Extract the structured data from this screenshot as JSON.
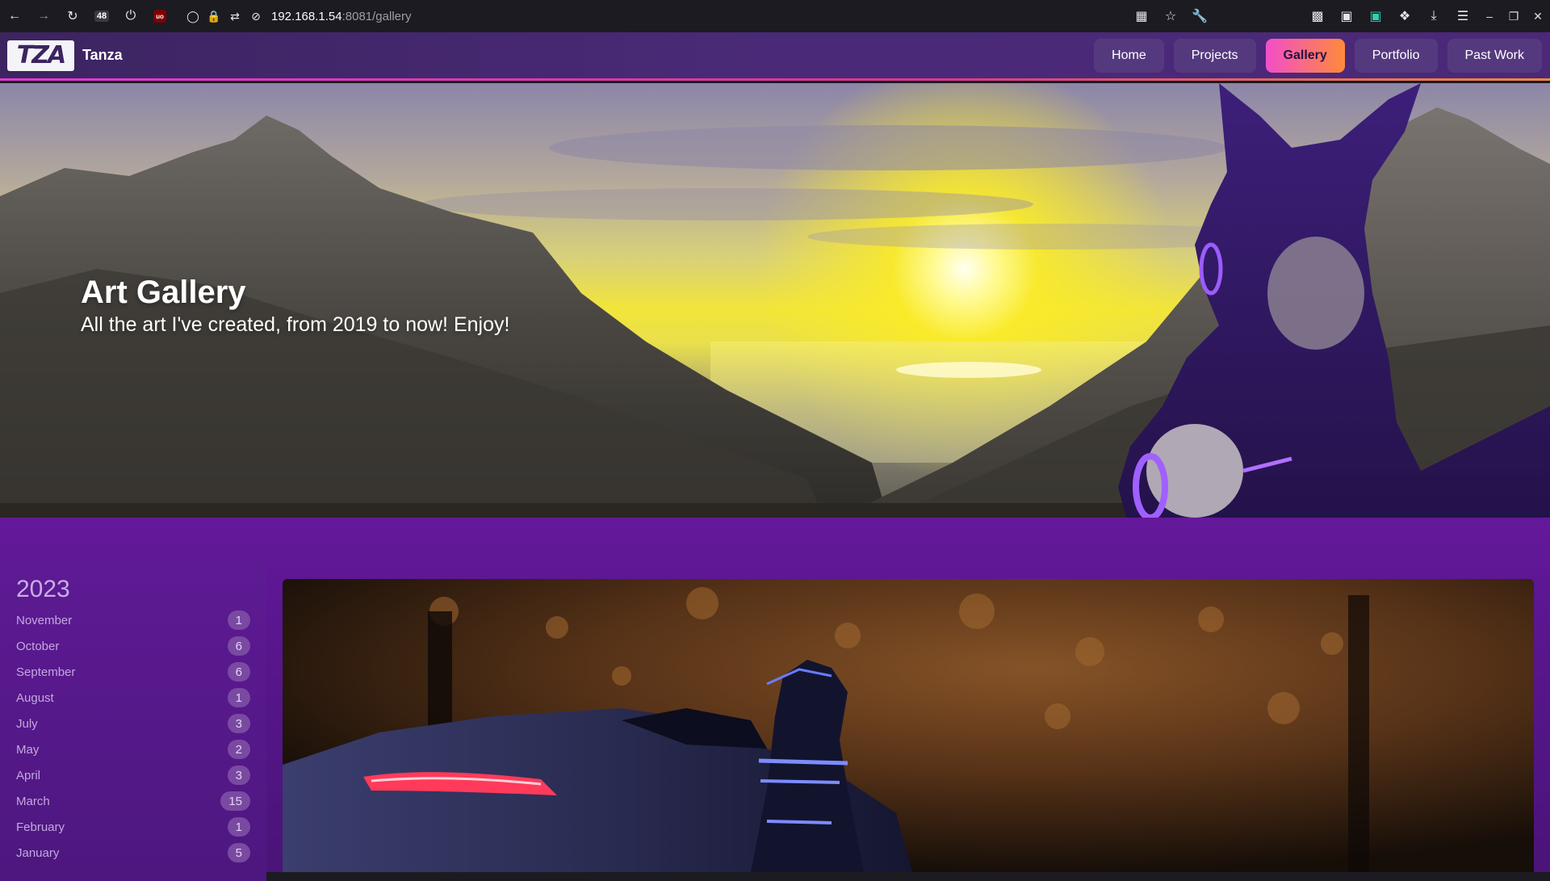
{
  "browser": {
    "badge_count": "48",
    "url_host": "192.168.1.54",
    "url_rest": ":8081/gallery"
  },
  "site": {
    "logo_text": "TZA",
    "brand": "Tanza",
    "nav": [
      {
        "label": "Home",
        "active": false
      },
      {
        "label": "Projects",
        "active": false
      },
      {
        "label": "Gallery",
        "active": true
      },
      {
        "label": "Portfolio",
        "active": false
      },
      {
        "label": "Past Work",
        "active": false
      }
    ]
  },
  "hero": {
    "title": "Art Gallery",
    "subtitle": "All the art I've created, from 2019 to now! Enjoy!"
  },
  "archive": {
    "year": "2023",
    "months": [
      {
        "name": "November",
        "count": "1"
      },
      {
        "name": "October",
        "count": "6"
      },
      {
        "name": "September",
        "count": "6"
      },
      {
        "name": "August",
        "count": "1"
      },
      {
        "name": "July",
        "count": "3"
      },
      {
        "name": "May",
        "count": "2"
      },
      {
        "name": "April",
        "count": "3"
      },
      {
        "name": "March",
        "count": "15"
      },
      {
        "name": "February",
        "count": "1"
      },
      {
        "name": "January",
        "count": "5"
      }
    ]
  },
  "colors": {
    "accent_gradient_start": "#f24ec9",
    "accent_gradient_end": "#ff8a3a",
    "navbar_bg": "#4a2a78",
    "section_bg": "#5a1690"
  }
}
